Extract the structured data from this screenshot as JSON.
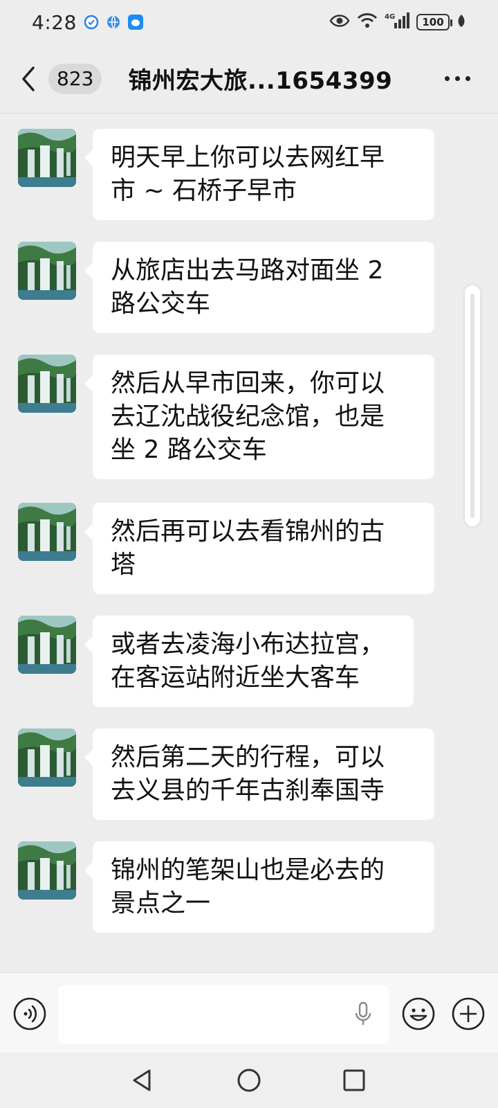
{
  "status_bar": {
    "time": "4:28",
    "battery": "100",
    "network": "4G"
  },
  "header": {
    "back_icon": "chevron-left-icon",
    "unread_count": "823",
    "title": "锦州宏大旅...1654399",
    "more_icon": "more-icon"
  },
  "messages": [
    {
      "text": "明天早上你可以去网红早\n市 ~ 石桥子早市",
      "avatar": "waterfall-avatar"
    },
    {
      "text": "从旅店出去马路对面坐 2\n路公交车",
      "avatar": "waterfall-avatar"
    },
    {
      "text": "然后从早市回来，你可以\n去辽沈战役纪念馆，也是\n坐 2 路公交车",
      "avatar": "waterfall-avatar"
    },
    {
      "text": "然后再可以去看锦州的古\n塔",
      "avatar": "waterfall-avatar"
    },
    {
      "text": "或者去凌海小布达拉宫，\n在客运站附近坐大客车",
      "avatar": "waterfall-avatar"
    },
    {
      "text": "然后第二天的行程，可以\n去义县的千年古刹奉国寺",
      "avatar": "waterfall-avatar"
    },
    {
      "text": "锦州的笔架山也是必去的\n景点之一",
      "avatar": "waterfall-avatar"
    }
  ],
  "input_bar": {
    "value": "",
    "placeholder": "",
    "icons": [
      "voice-icon",
      "microphone-icon",
      "emoji-icon",
      "plus-icon"
    ]
  },
  "colors": {
    "background": "#ededed",
    "bubble": "#ffffff",
    "text": "#111111"
  }
}
